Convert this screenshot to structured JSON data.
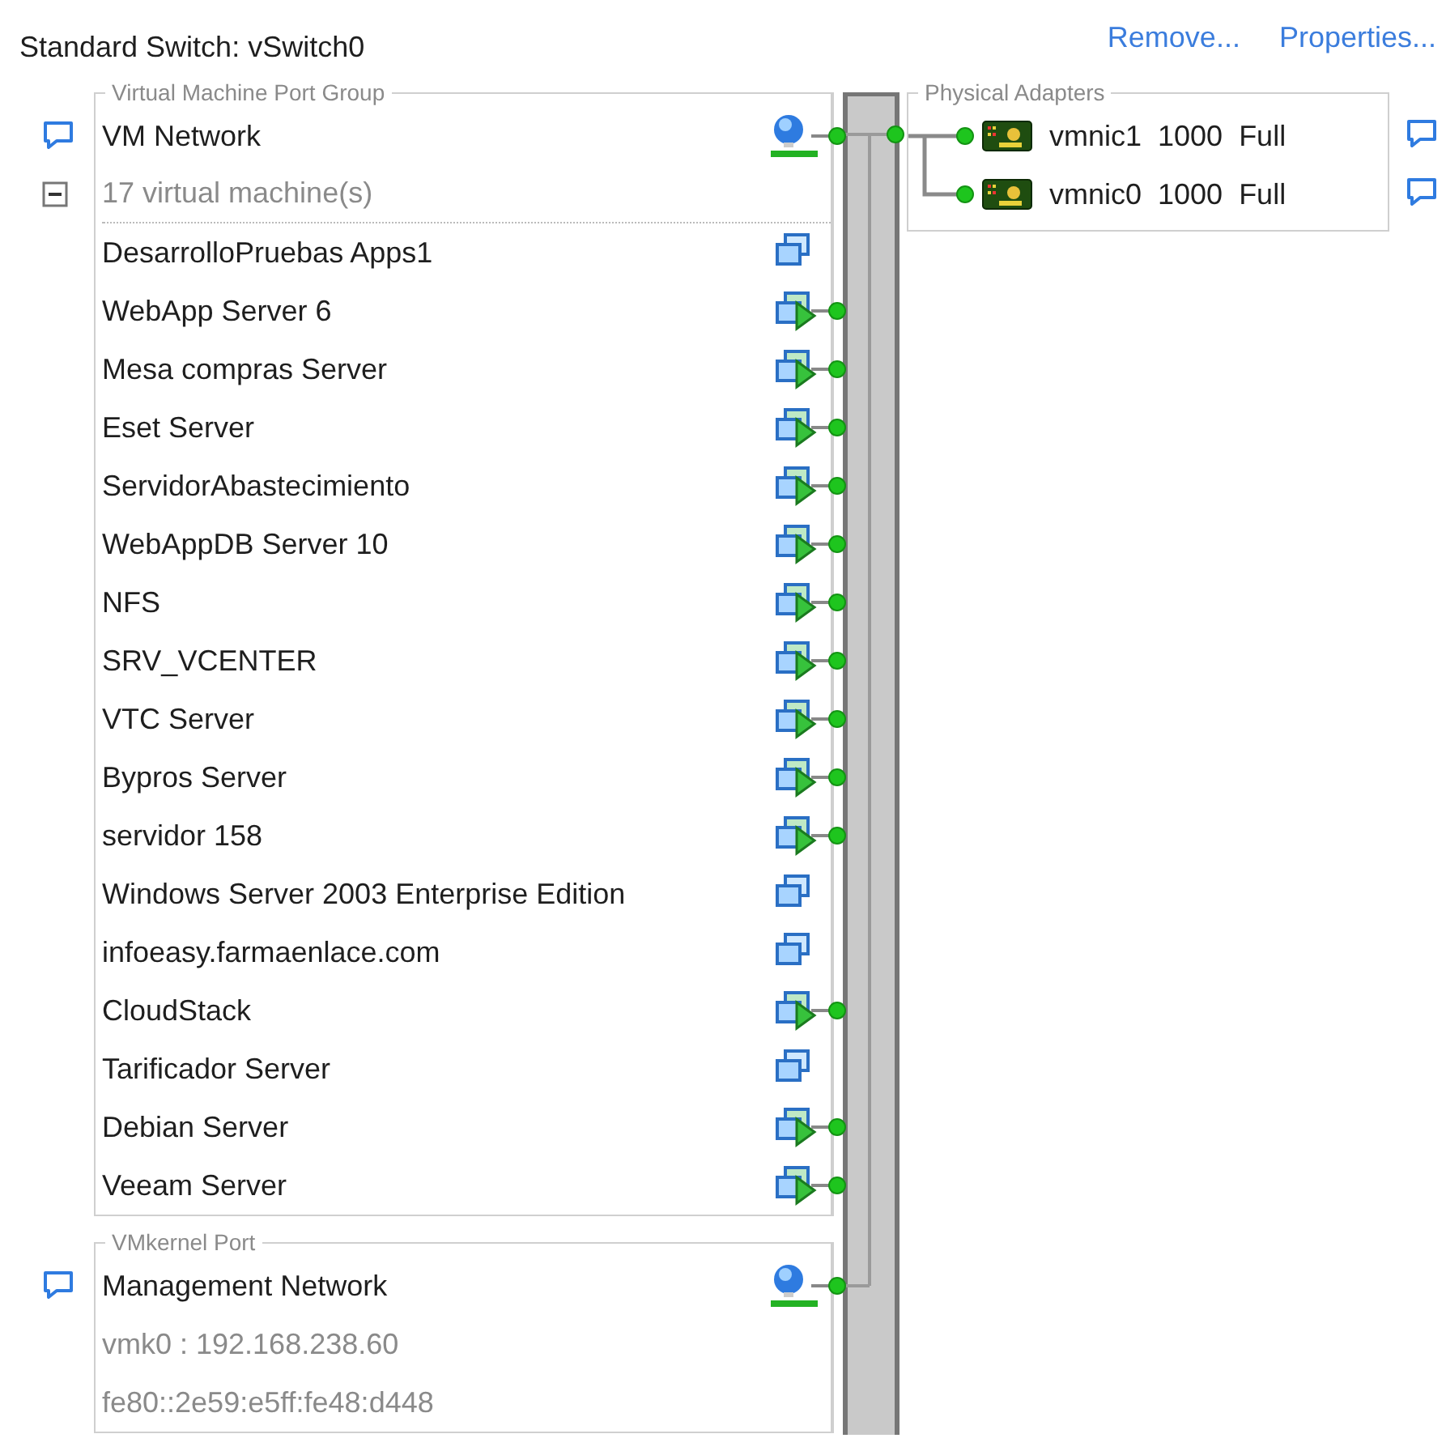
{
  "header": {
    "title": "Standard Switch: vSwitch0",
    "links": [
      "Remove...",
      "Properties..."
    ]
  },
  "port_groups": [
    {
      "kind": "vm",
      "legend": "Virtual Machine Port Group",
      "name": "VM Network",
      "count": "17 virtual machine(s)",
      "expanded": true,
      "vms": [
        {
          "name": "DesarrolloPruebas Apps1",
          "powered_on": false
        },
        {
          "name": "WebApp Server 6",
          "powered_on": true
        },
        {
          "name": "Mesa compras Server",
          "powered_on": true
        },
        {
          "name": "Eset Server",
          "powered_on": true
        },
        {
          "name": "ServidorAbastecimiento",
          "powered_on": true
        },
        {
          "name": "WebAppDB Server 10",
          "powered_on": true
        },
        {
          "name": "NFS",
          "powered_on": true
        },
        {
          "name": "SRV_VCENTER",
          "powered_on": true
        },
        {
          "name": "VTC Server",
          "powered_on": true
        },
        {
          "name": "Bypros Server",
          "powered_on": true
        },
        {
          "name": "servidor 158",
          "powered_on": true
        },
        {
          "name": "Windows Server 2003 Enterprise Edition",
          "powered_on": false
        },
        {
          "name": "infoeasy.farmaenlace.com",
          "powered_on": false
        },
        {
          "name": "CloudStack",
          "powered_on": true
        },
        {
          "name": "Tarificador Server",
          "powered_on": false
        },
        {
          "name": "Debian Server",
          "powered_on": true
        },
        {
          "name": "Veeam Server",
          "powered_on": true
        }
      ]
    },
    {
      "kind": "vmkernel",
      "legend": "VMkernel Port",
      "name": "Management Network",
      "details": [
        "vmk0 : 192.168.238.60",
        "fe80::2e59:e5ff:fe48:d448"
      ]
    }
  ],
  "physical_adapters": {
    "legend": "Physical Adapters",
    "adapters": [
      {
        "name": "vmnic1",
        "speed": "1000",
        "duplex": "Full"
      },
      {
        "name": "vmnic0",
        "speed": "1000",
        "duplex": "Full"
      }
    ]
  }
}
